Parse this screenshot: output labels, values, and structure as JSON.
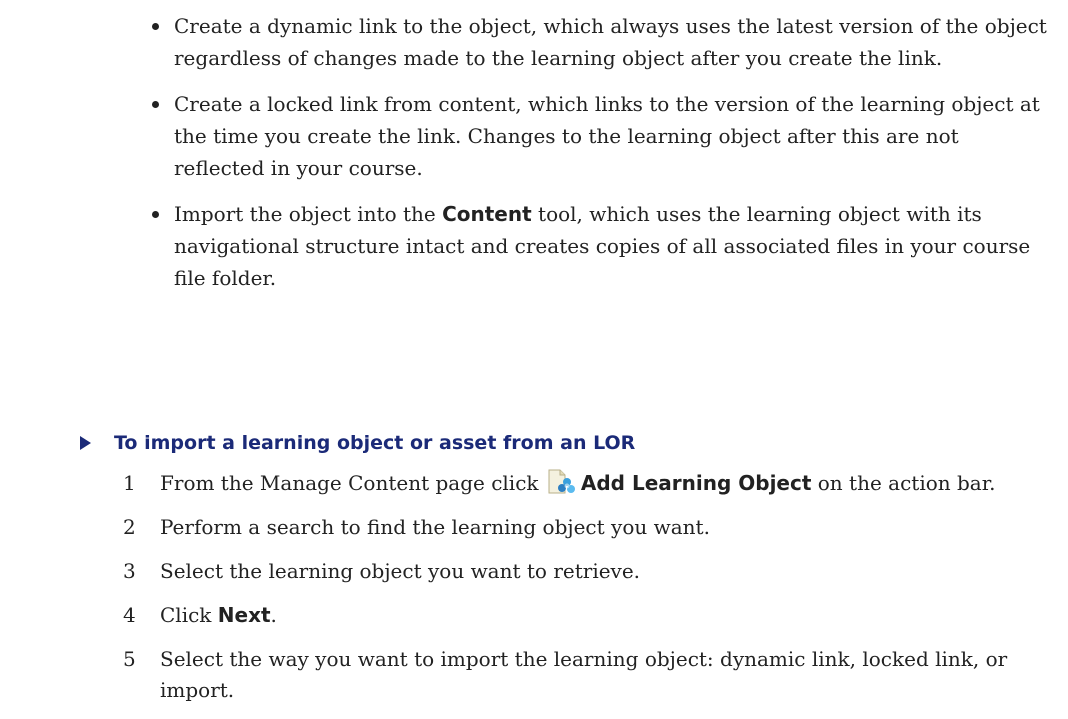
{
  "bullets": [
    {
      "text": "Create a dynamic link to the object, which always uses the latest version of the object regardless of changes made to the learning object after you create the link."
    },
    {
      "text": "Create a locked link from content, which links to the version of the learning object at the time you create the link. Changes to the learning object after this are not reflected in your course."
    },
    {
      "before": "Import the object into the ",
      "bold": "Content",
      "after": " tool, which uses the learning object with its navigational structure intact and creates copies of all associated files in your course file folder."
    }
  ],
  "procedure": {
    "heading": "To import a learning object or asset from an LOR",
    "heading_color": "#1b2a78",
    "steps": [
      {
        "num": "1",
        "before": "From the Manage Content page click ",
        "icon": "add-learning-object-icon",
        "bold": "Add Learning Object",
        "after": " on the action bar."
      },
      {
        "num": "2",
        "text": "Perform a search to find the learning object you want."
      },
      {
        "num": "3",
        "text": "Select the learning object you want to retrieve."
      },
      {
        "num": "4",
        "before": "Click ",
        "bold": "Next",
        "after": "."
      },
      {
        "num": "5",
        "text": "Select the way you want to import the learning object: dynamic link, locked link, or import."
      }
    ]
  }
}
